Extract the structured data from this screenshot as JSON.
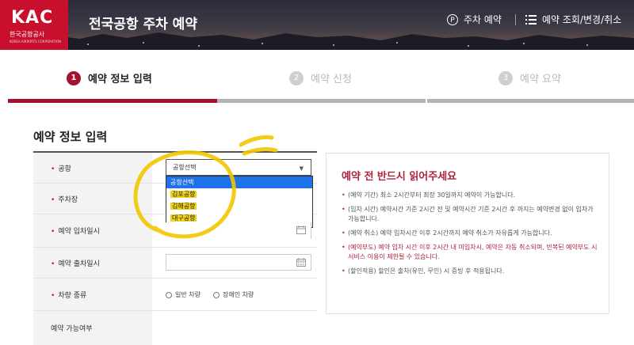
{
  "header": {
    "logo_text": "KAC",
    "logo_korean": "한국공항공사",
    "logo_english": "KOREA AIRPORTS CORPORATION",
    "title": "전국공항 주차 예약",
    "nav": {
      "reserve_icon": "P",
      "reserve_label": "주차 예약",
      "manage_label": "예약 조회/변경/취소"
    }
  },
  "steps": [
    {
      "num": "1",
      "label": "예약 정보 입력",
      "active": true
    },
    {
      "num": "2",
      "label": "예약 신청",
      "active": false
    },
    {
      "num": "3",
      "label": "예약 요약",
      "active": false
    }
  ],
  "progress": {
    "current_step": 1,
    "total_steps": 3
  },
  "form": {
    "section_title": "예약 정보 입력",
    "bullet": "•",
    "fields": {
      "airport": "공항",
      "parking_lot": "주차장",
      "entry_datetime": "예약 입차일시",
      "exit_datetime": "예약 출차일시",
      "vehicle_type": "차량 종류",
      "availability": "예약 가능여부"
    },
    "airport_select": {
      "value": "공항선택",
      "caret": "▼",
      "options": [
        "공항선택",
        "김포공항",
        "김해공항",
        "대구공항"
      ]
    },
    "vehicle_options": [
      "일반 차량",
      "장애인 차량"
    ]
  },
  "notice": {
    "title": "예약 전 반드시 읽어주세요",
    "items": [
      {
        "text": "(예약 기간) 최소 2시간부터 최장 30일까지 예약이 가능합니다.",
        "warn": false
      },
      {
        "text": "(입차 시간) 예약시간 기준 2시간 전 및 예약시간 기준 2시간 후 까지는 예약변경 없이 입차가 가능합니다.",
        "warn": false
      },
      {
        "text": "(예약 취소) 예약 입차시간 이후 2시간까지 예약 취소가 자유롭게 가능합니다.",
        "warn": false
      },
      {
        "text": "(예약부도) 예약 입차 시간 이후 2시간 내 미입차시, 예약은 자동 취소되며, 반복된 예약부도 시 서비스 이용이 제한될 수 있습니다.",
        "warn": true
      },
      {
        "text": "(할인적용) 할인은 출차(유인, 무인) 시 증빙 후 적용됩니다.",
        "warn": false
      }
    ]
  },
  "colors": {
    "brand_red": "#c8102e",
    "step_active": "#a3122e",
    "highlight_yellow": "#f1d21a",
    "select_blue": "#1e73e8"
  }
}
